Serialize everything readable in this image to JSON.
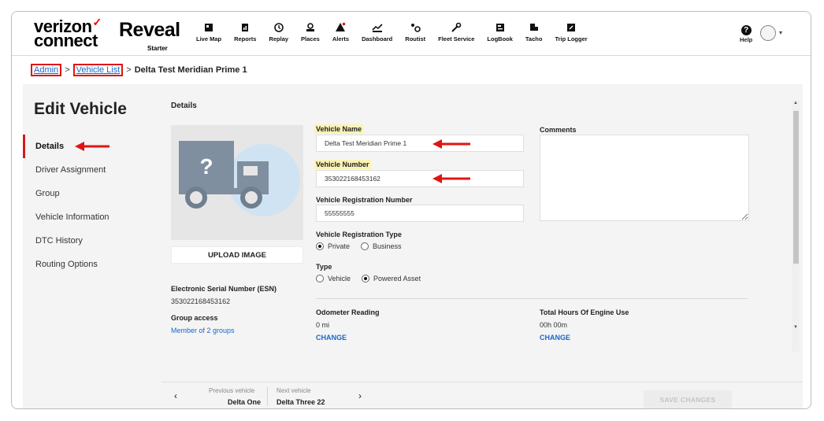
{
  "brand": {
    "line1": "verizon",
    "line2": "connect",
    "product": "Reveal",
    "product_sub": "Starter"
  },
  "nav": [
    {
      "label": "Live Map",
      "icon": "live-map-icon"
    },
    {
      "label": "Reports",
      "icon": "reports-icon"
    },
    {
      "label": "Replay",
      "icon": "replay-icon"
    },
    {
      "label": "Places",
      "icon": "places-icon"
    },
    {
      "label": "Alerts",
      "icon": "alerts-icon"
    },
    {
      "label": "Dashboard",
      "icon": "dashboard-icon"
    },
    {
      "label": "Routist",
      "icon": "routist-icon"
    },
    {
      "label": "Fleet Service",
      "icon": "fleet-service-icon"
    },
    {
      "label": "LogBook",
      "icon": "logbook-icon"
    },
    {
      "label": "Tacho",
      "icon": "tacho-icon"
    },
    {
      "label": "Trip Logger",
      "icon": "trip-logger-icon"
    }
  ],
  "help": {
    "label": "Help",
    "glyph": "?"
  },
  "breadcrumb": {
    "admin": "Admin",
    "vehicle_list": "Vehicle List",
    "current": "Delta Test Meridian Prime 1",
    "sep": ">"
  },
  "page_title": "Edit Vehicle",
  "sidebar": [
    {
      "label": "Details",
      "active": true
    },
    {
      "label": "Driver Assignment",
      "active": false
    },
    {
      "label": "Group",
      "active": false
    },
    {
      "label": "Vehicle Information",
      "active": false
    },
    {
      "label": "DTC History",
      "active": false
    },
    {
      "label": "Routing Options",
      "active": false
    }
  ],
  "details": {
    "section_title": "Details",
    "upload_label": "UPLOAD IMAGE",
    "esn_label": "Electronic Serial Number (ESN)",
    "esn_value": "353022168453162",
    "group_access_label": "Group access",
    "group_access_link": "Member of 2 groups",
    "vehicle_name_label": "Vehicle Name",
    "vehicle_name_value": "Delta Test Meridian Prime 1",
    "vehicle_number_label": "Vehicle Number",
    "vehicle_number_value": "353022168453162",
    "reg_number_label": "Vehicle Registration Number",
    "reg_number_value": "55555555",
    "reg_type_label": "Vehicle Registration Type",
    "reg_type_options": [
      "Private",
      "Business"
    ],
    "reg_type_selected": "Private",
    "type_label": "Type",
    "type_options": [
      "Vehicle",
      "Powered Asset"
    ],
    "type_selected": "Powered Asset",
    "comments_label": "Comments",
    "odometer_label": "Odometer Reading",
    "odometer_value": "0 mi",
    "odometer_change": "CHANGE",
    "engine_hours_label": "Total Hours Of Engine Use",
    "engine_hours_value": "00h 00m",
    "engine_hours_change": "CHANGE"
  },
  "footer": {
    "prev_label": "Previous vehicle",
    "prev_name": "Delta One",
    "next_label": "Next vehicle",
    "next_name": "Delta Three 22",
    "save_label": "SAVE CHANGES"
  },
  "colors": {
    "accent": "#1a66c9",
    "annotation": "#e01414",
    "highlight": "#fbf3b6",
    "brand_check": "#ee0000"
  }
}
